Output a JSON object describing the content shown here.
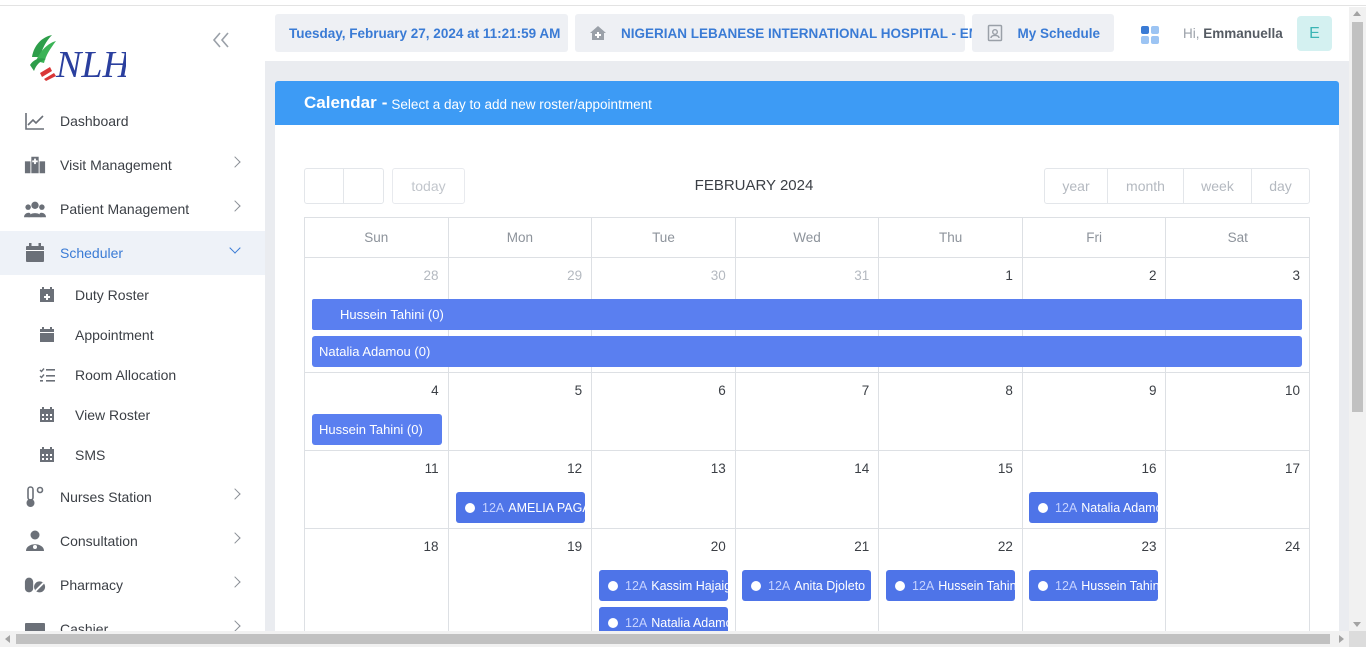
{
  "topbar": {
    "datetime": "Tuesday, February 27, 2024 at 11:21:59 AM",
    "hospital": "NIGERIAN LEBANESE INTERNATIONAL HOSPITAL - EMR",
    "schedule": "My Schedule",
    "greeting_prefix": "Hi,",
    "user_name": "Emmanuella",
    "avatar_letter": "E"
  },
  "sidebar": {
    "logo_text": "NLH",
    "items": [
      {
        "label": "Dashboard",
        "icon": "chart-line-icon"
      },
      {
        "label": "Visit Management",
        "icon": "hospital-icon"
      },
      {
        "label": "Patient Management",
        "icon": "users-icon"
      },
      {
        "label": "Scheduler",
        "icon": "calendar-icon"
      },
      {
        "label": "Nurses Station",
        "icon": "thermometer-icon"
      },
      {
        "label": "Consultation",
        "icon": "doctor-icon"
      },
      {
        "label": "Pharmacy",
        "icon": "pills-icon"
      },
      {
        "label": "Cashier",
        "icon": "cash-register-icon"
      }
    ],
    "sub_items": [
      {
        "label": "Duty Roster",
        "icon": "calendar-plus-icon"
      },
      {
        "label": "Appointment",
        "icon": "calendar-icon"
      },
      {
        "label": "Room Allocation",
        "icon": "list-check-icon"
      },
      {
        "label": "View Roster",
        "icon": "calendar-grid-icon"
      },
      {
        "label": "SMS",
        "icon": "calendar-grid-icon"
      }
    ]
  },
  "calendar": {
    "title": "Calendar",
    "subtitle": "Select a day to add new roster/appointment",
    "month_label": "FEBRUARY 2024",
    "today_label": "today",
    "views": [
      "year",
      "month",
      "week",
      "day"
    ],
    "weekdays": [
      "Sun",
      "Mon",
      "Tue",
      "Wed",
      "Thu",
      "Fri",
      "Sat"
    ],
    "weeks": [
      [
        "28",
        "29",
        "30",
        "31",
        "1",
        "2",
        "3"
      ],
      [
        "4",
        "5",
        "6",
        "7",
        "8",
        "9",
        "10"
      ],
      [
        "11",
        "12",
        "13",
        "14",
        "15",
        "16",
        "17"
      ],
      [
        "18",
        "19",
        "20",
        "21",
        "22",
        "23",
        "24"
      ]
    ],
    "roster_bars": [
      "Hussein Tahini (0)",
      "Natalia Adamou (0)",
      "Hussein Tahini (0)"
    ],
    "appointments": [
      {
        "time": "12A",
        "name": "AMELIA PAGARIGAN"
      },
      {
        "time": "12A",
        "name": "Natalia Adamou"
      },
      {
        "time": "12A",
        "name": "Kassim Hajaig"
      },
      {
        "time": "12A",
        "name": "Anita Djoleto"
      },
      {
        "time": "12A",
        "name": "Hussein Tahini"
      },
      {
        "time": "12A",
        "name": "Hussein Tahini"
      },
      {
        "time": "12A",
        "name": "Natalia Adamou"
      }
    ]
  }
}
